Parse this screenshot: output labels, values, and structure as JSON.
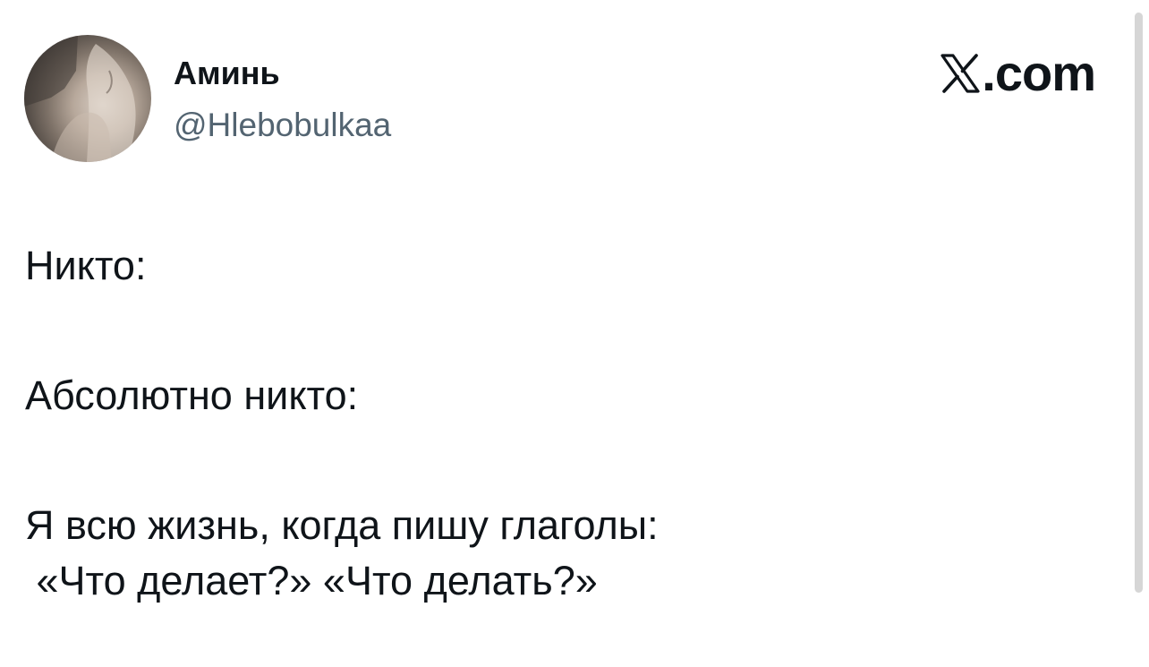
{
  "author": {
    "display_name": "Аминь",
    "handle": "@Hlebobulkaa",
    "avatar_icon": "profile-avatar-photo"
  },
  "brand": {
    "icon": "x-logo-icon",
    "text": ".com"
  },
  "tweet": {
    "lines": [
      "Никто:",
      "Абсолютно никто:",
      "Я всю жизнь, когда пишу глаголы:",
      " «Что делает?» «Что делать?»"
    ]
  },
  "colors": {
    "text": "#0f1419",
    "secondary": "#536471",
    "background": "#ffffff"
  }
}
